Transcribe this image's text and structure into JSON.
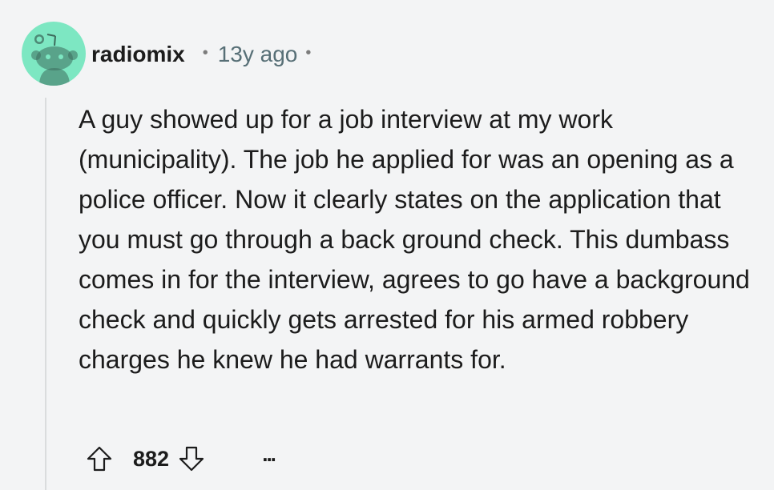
{
  "comment": {
    "username": "radiomix",
    "separator": "•",
    "timestamp": "13y ago",
    "trailing_separator": "•",
    "body": "A guy showed up for a job interview at my work (municipality). The job he applied for was an opening as a police officer. Now it clearly states on the application that you must go through a back ground check. This dumbass comes in for the interview, agrees to go have a background check and quickly gets arrested for his armed robbery charges he knew he had warrants for.",
    "score": "882",
    "more_label": "..."
  },
  "icons": {
    "avatar": "snoo-avatar",
    "upvote": "upvote-arrow-icon",
    "downvote": "downvote-arrow-icon",
    "more": "more-options-icon"
  },
  "colors": {
    "background": "#f3f4f5",
    "avatar_bg": "#7de7c2",
    "text": "#1c1c1c",
    "meta": "#576f76",
    "thread_line": "#dadcdd"
  }
}
